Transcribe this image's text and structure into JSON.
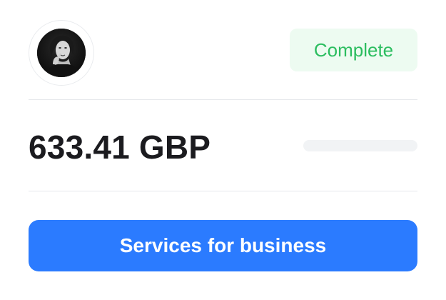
{
  "profile": {
    "avatar_icon": "avatar-icon"
  },
  "status": {
    "label": "Complete",
    "color": "#2bbd5f",
    "background": "#edfbf1"
  },
  "payment": {
    "amount": "633.41 GBP"
  },
  "actions": {
    "primary_label": "Services for business",
    "primary_color": "#2b7bff"
  }
}
